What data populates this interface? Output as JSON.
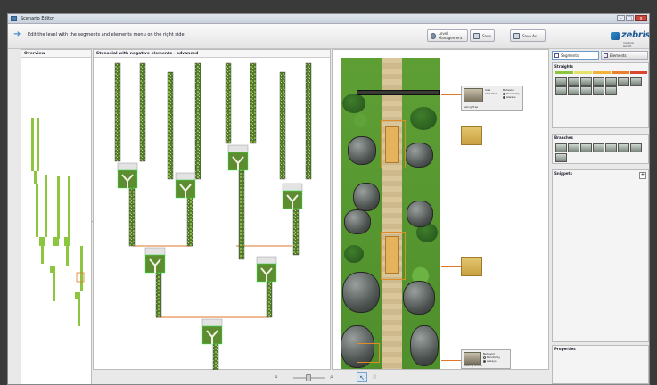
{
  "window": {
    "title": "Scenario Editor",
    "controls": [
      "–",
      "□",
      "x"
    ]
  },
  "toolbar": {
    "instruction": "Edit the level with the segments and elements menu on the right side.",
    "buttons": [
      {
        "label": "Level Management",
        "icon": "level-management-icon"
      },
      {
        "label": "Save",
        "icon": "save-icon"
      },
      {
        "label": "Save As",
        "icon": "save-as-icon"
      }
    ],
    "logo": {
      "word": "zebris",
      "tagline": "medical GmbH"
    }
  },
  "overview": {
    "title": "Overview"
  },
  "editor": {
    "title": "Stenosial with negative elements - advanced"
  },
  "scene": {
    "callouts": {
      "top": {
        "caption": "Swing Trap",
        "size_label": "Size",
        "size_value": "100.00 %",
        "unit": "%",
        "behavior_label": "Behavior",
        "options": [
          "Randomly",
          "Always"
        ],
        "selected": 1
      },
      "bottom": {
        "caption": "Waving Rocks",
        "behavior_label": "Behavior",
        "options": [
          "Randomly",
          "Always"
        ],
        "selected": 1
      }
    }
  },
  "right_panel": {
    "tabs": [
      "Segments",
      "Elements"
    ],
    "active_tab": 0,
    "sections": {
      "straights": "Straights",
      "branches": "Branches",
      "snippets": "Snippets",
      "properties": "Properties"
    },
    "difficulty_colors": [
      "#8cc63f",
      "#e4e16b",
      "#f0b23b",
      "#ea7f2d",
      "#d9462d"
    ]
  },
  "bottom_bar": {
    "zoom_out_icon": "zoom-out-icon",
    "zoom_in_icon": "zoom-in-icon",
    "select_tool_icon": "pointer-icon",
    "hand_tool_icon": "hand-icon"
  }
}
